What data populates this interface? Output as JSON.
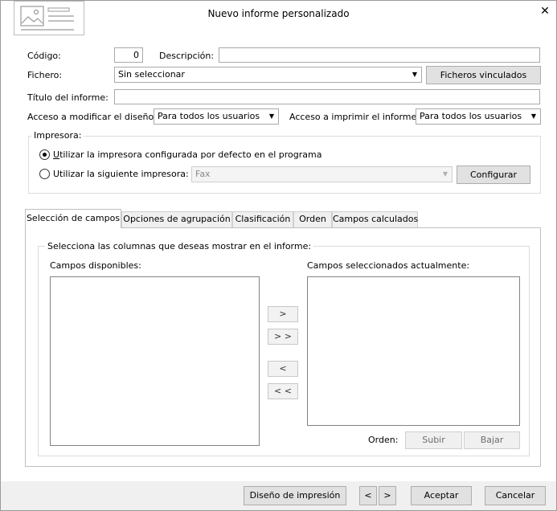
{
  "dialog": {
    "title": "Nuevo informe personalizado",
    "icon": "report-image-icon",
    "close_glyph": "✕"
  },
  "form": {
    "codigo_label": "Código:",
    "codigo_value": "0",
    "descripcion_label": "Descripción:",
    "descripcion_value": "",
    "fichero_label": "Fichero:",
    "fichero_value": "Sin seleccionar",
    "ficheros_vinculados_button": "Ficheros vinculados",
    "titulo_label": "Título del informe:",
    "titulo_value": "",
    "acceso_modificar_label": "Acceso a modificar el diseño:",
    "acceso_modificar_value": "Para todos los usuarios",
    "acceso_imprimir_label": "Acceso a imprimir el informe:",
    "acceso_imprimir_value": "Para todos los usuarios"
  },
  "printer": {
    "group_title": "Impresora:",
    "option_default_prefix": "U",
    "option_default_rest": "tilizar la impresora configurada por defecto en el programa",
    "option_default_selected": true,
    "option_specific_label": "Utilizar la siguiente impresora:",
    "option_specific_selected": false,
    "printer_value": "Fax",
    "configurar_button": "Configurar"
  },
  "tabs": [
    {
      "label": "Selección de campos",
      "active": true
    },
    {
      "label": "Opciones de agrupación",
      "active": false
    },
    {
      "label": "Clasificación",
      "active": false
    },
    {
      "label": "Orden",
      "active": false
    },
    {
      "label": "Campos calculados",
      "active": false
    }
  ],
  "fields_panel": {
    "group_title": "Selecciona las columnas que deseas mostrar en el informe:",
    "available_label": "Campos disponibles:",
    "available_items": [],
    "selected_label": "Campos seleccionados actualmente:",
    "selected_items": [],
    "add_button": ">",
    "add_all_button": "> >",
    "remove_button": "<",
    "remove_all_button": "< <",
    "orden_label": "Orden:",
    "subir_button": "Subir",
    "bajar_button": "Bajar"
  },
  "footer": {
    "diseno_button": "Diseño de impresión",
    "prev_button": "<",
    "next_button": ">",
    "aceptar_button": "Aceptar",
    "cancelar_button": "Cancelar"
  }
}
